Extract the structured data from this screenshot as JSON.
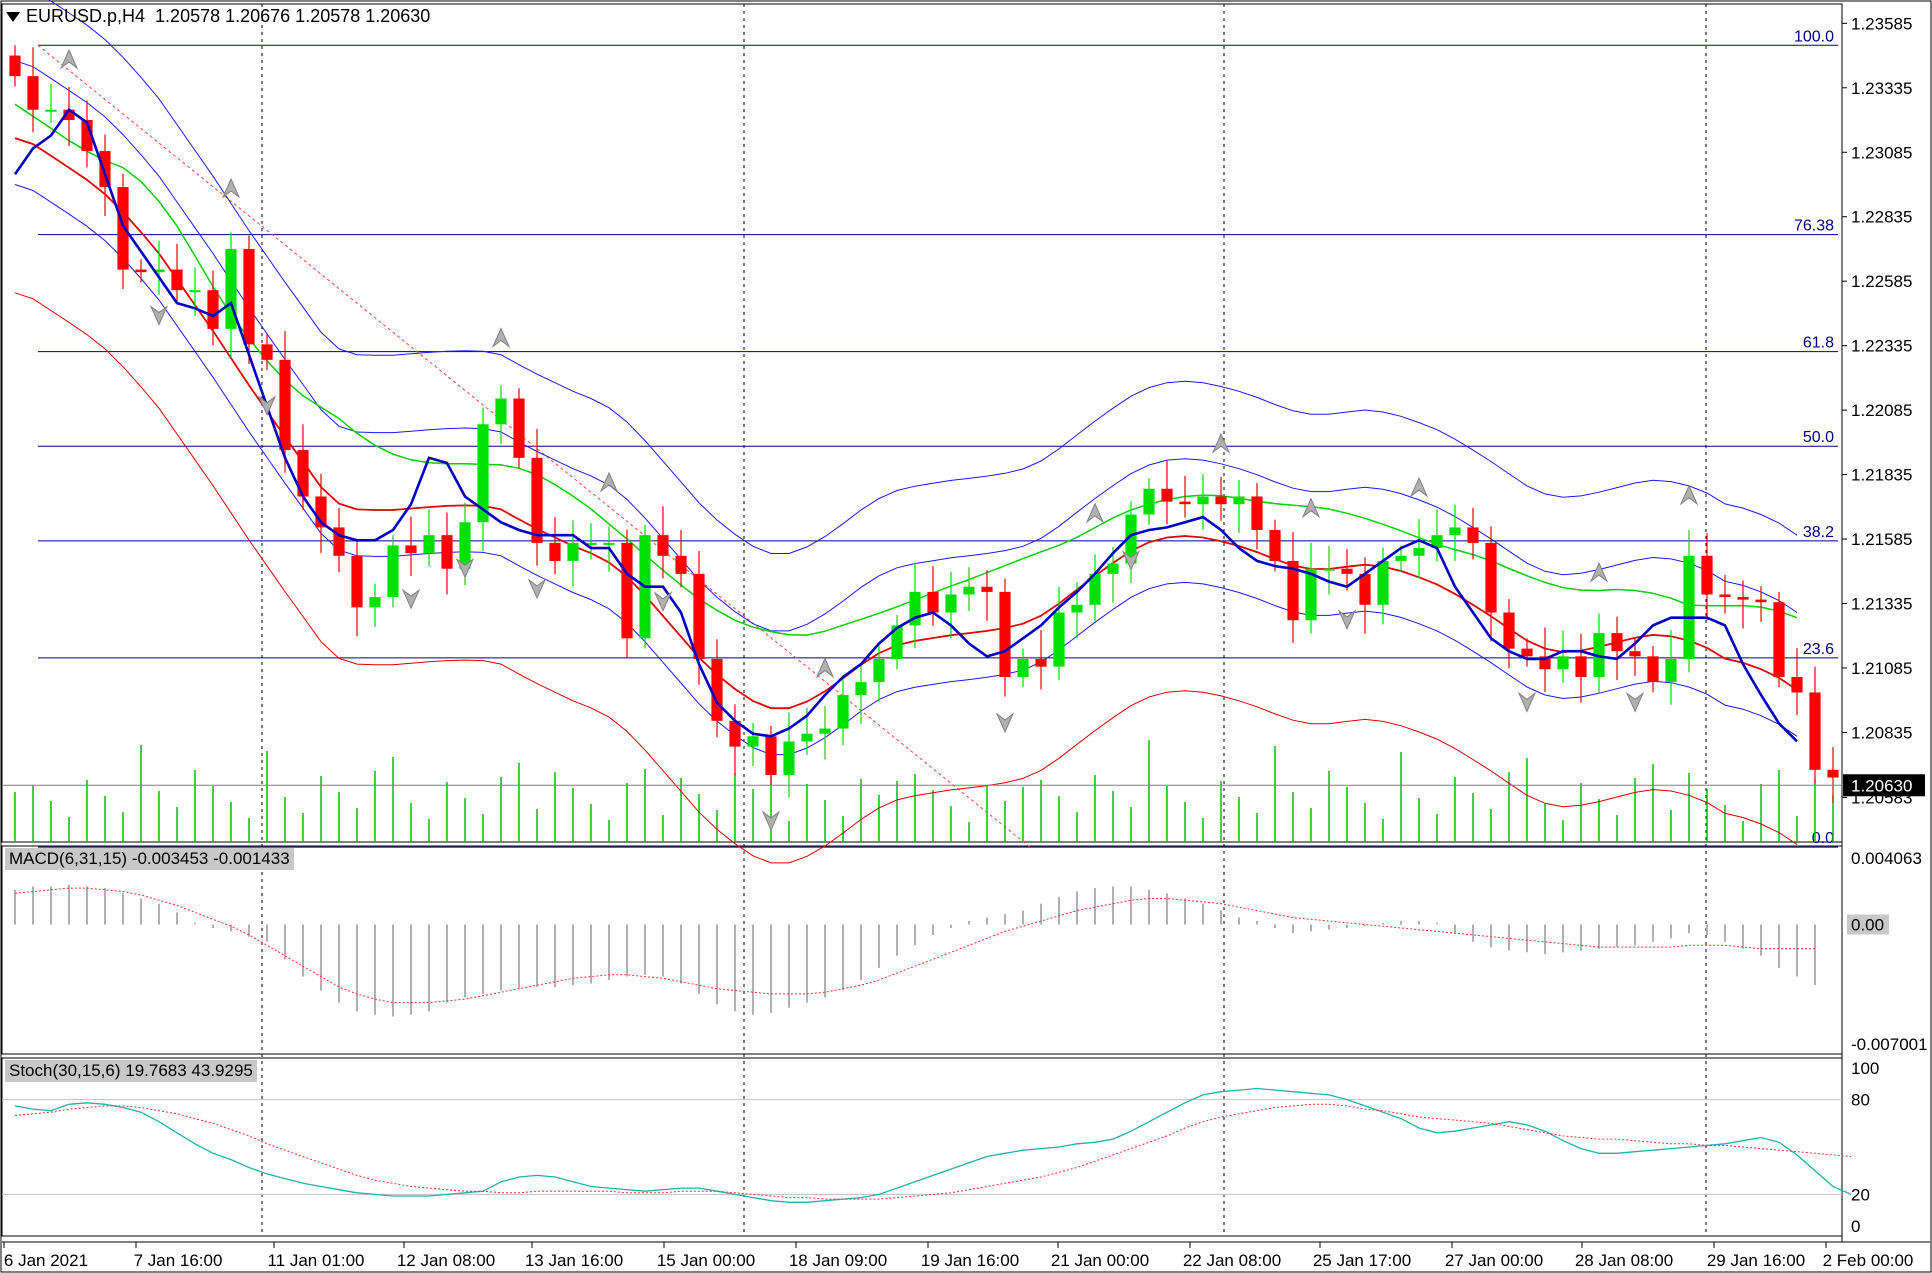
{
  "header": {
    "symbol": "EURUSD.p,H4",
    "ohlc": "1.20578 1.20676 1.20578 1.20630"
  },
  "price_axis": {
    "ticks": [
      "1.23585",
      "1.23335",
      "1.23085",
      "1.22835",
      "1.22585",
      "1.22335",
      "1.22085",
      "1.21835",
      "1.21585",
      "1.21335",
      "1.21085",
      "1.20835",
      "1.20583"
    ],
    "current_price": "1.20630"
  },
  "fib_levels": [
    "100.0",
    "76.38",
    "61.8",
    "50.0",
    "38.2",
    "23.6",
    "0.0"
  ],
  "time_axis": [
    "6 Jan 2021",
    "7 Jan 16:00",
    "11 Jan 01:00",
    "12 Jan 08:00",
    "13 Jan 16:00",
    "15 Jan 00:00",
    "18 Jan 09:00",
    "19 Jan 16:00",
    "21 Jan 00:00",
    "22 Jan 08:00",
    "25 Jan 17:00",
    "27 Jan 00:00",
    "28 Jan 08:00",
    "29 Jan 16:00",
    "2 Feb 00:00"
  ],
  "macd": {
    "label": "MACD(6,31,15) -0.003453 -0.001433",
    "ticks": [
      "0.004063",
      "0.00",
      "-0.007001"
    ]
  },
  "stoch": {
    "label": "Stoch(30,15,6) 19.7683 43.9295",
    "ticks": [
      "100",
      "80",
      "20",
      "0"
    ]
  },
  "colors": {
    "bull": "#00e000",
    "bear": "#ff0000",
    "ma_blue": "#0000c0",
    "band_blue": "#1a1aff",
    "ma_green": "#00d000",
    "ma_red": "#e00000",
    "volume": "#00c000",
    "stoch_main": "#20b2aa",
    "signal": "#ff3030"
  },
  "chart_data": [
    {
      "type": "candlestick",
      "title": "EURUSD.p,H4",
      "ylim": [
        1.2041,
        1.2366
      ],
      "x_categories": [
        "6 Jan 2021",
        "7 Jan 16:00",
        "11 Jan 01:00",
        "12 Jan 08:00",
        "13 Jan 16:00",
        "15 Jan 00:00",
        "18 Jan 09:00",
        "19 Jan 16:00",
        "21 Jan 00:00",
        "22 Jan 08:00",
        "25 Jan 17:00",
        "27 Jan 00:00",
        "28 Jan 08:00",
        "29 Jan 16:00",
        "2 Feb 00:00"
      ],
      "close": [
        1.2338,
        1.2325,
        1.2325,
        1.2321,
        1.2309,
        1.2295,
        1.2263,
        1.2262,
        1.2263,
        1.2255,
        1.2255,
        1.224,
        1.2271,
        1.2234,
        1.2228,
        1.2193,
        1.2175,
        1.2163,
        1.2152,
        1.2132,
        1.2136,
        1.2156,
        1.2153,
        1.216,
        1.2147,
        1.2165,
        1.2203,
        1.2213,
        1.219,
        1.2157,
        1.215,
        1.2157,
        1.2157,
        1.2157,
        1.212,
        1.216,
        1.2152,
        1.2145,
        1.2112,
        1.2088,
        1.2078,
        1.2082,
        1.2067,
        1.208,
        1.2083,
        1.2085,
        1.2098,
        1.2103,
        1.2112,
        1.2125,
        1.2138,
        1.213,
        1.2137,
        1.214,
        1.2138,
        1.2105,
        1.2112,
        1.2109,
        1.213,
        1.2133,
        1.2145,
        1.2149,
        1.2168,
        1.2178,
        1.2173,
        1.2172,
        1.2175,
        1.2172,
        1.2175,
        1.2162,
        1.215,
        1.2127,
        1.2147,
        1.2147,
        1.2145,
        1.2133,
        1.215,
        1.2152,
        1.2155,
        1.216,
        1.2163,
        1.2157,
        1.213,
        1.2116,
        1.2113,
        1.2108,
        1.2113,
        1.2105,
        1.2122,
        1.2115,
        1.2113,
        1.2103,
        1.2112,
        1.2152,
        1.2137,
        1.2136,
        1.2135,
        1.2134,
        1.2105,
        1.2099,
        1.2069,
        1.2066
      ],
      "ma_fast_blue": [
        1.23,
        1.231,
        1.2315,
        1.2325,
        1.232,
        1.23,
        1.228,
        1.227,
        1.226,
        1.225,
        1.2248,
        1.2245,
        1.225,
        1.223,
        1.221,
        1.219,
        1.2175,
        1.2165,
        1.216,
        1.2158,
        1.2158,
        1.2162,
        1.2172,
        1.219,
        1.2188,
        1.2175,
        1.217,
        1.2165,
        1.2162,
        1.216,
        1.216,
        1.216,
        1.2155,
        1.2155,
        1.2145,
        1.214,
        1.214,
        1.213,
        1.211,
        1.2095,
        1.2088,
        1.2083,
        1.2082,
        1.2085,
        1.209,
        1.2098,
        1.2105,
        1.211,
        1.2118,
        1.2124,
        1.2128,
        1.213,
        1.2125,
        1.2118,
        1.2113,
        1.2115,
        1.212,
        1.2125,
        1.2132,
        1.2138,
        1.2145,
        1.2153,
        1.216,
        1.2162,
        1.2163,
        1.2165,
        1.2167,
        1.2162,
        1.2155,
        1.215,
        1.2148,
        1.2147,
        1.2145,
        1.2142,
        1.214,
        1.2145,
        1.215,
        1.2155,
        1.2158,
        1.2155,
        1.214,
        1.213,
        1.212,
        1.2115,
        1.2112,
        1.2112,
        1.2115,
        1.2115,
        1.2113,
        1.2112,
        1.2118,
        1.2125,
        1.2128,
        1.2128,
        1.2128,
        1.2125,
        1.211,
        1.2098,
        1.2087,
        1.208
      ]
    },
    {
      "type": "bar",
      "title": "MACD(6,31,15) -0.003453 -0.001433",
      "ylim": [
        -0.007001,
        0.004063
      ],
      "series": [
        {
          "name": "MACD(6,31,15)",
          "values": [
            0.002,
            0.0022,
            0.0022,
            0.0023,
            0.0022,
            0.0021,
            0.0018,
            0.0015,
            0.0012,
            0.0007,
            0.0001,
            -0.0002,
            -0.0004,
            -0.0007,
            -0.001,
            -0.002,
            -0.003,
            -0.0038,
            -0.0045,
            -0.005,
            -0.0052,
            -0.0053,
            -0.0052,
            -0.005,
            -0.0045,
            -0.0042,
            -0.004,
            -0.0038,
            -0.0037,
            -0.0036,
            -0.0036,
            -0.0035,
            -0.0034,
            -0.0032,
            -0.003,
            -0.0029,
            -0.003,
            -0.0034,
            -0.004,
            -0.0046,
            -0.005,
            -0.0052,
            -0.0051,
            -0.0048,
            -0.0045,
            -0.0042,
            -0.0038,
            -0.0032,
            -0.0025,
            -0.0018,
            -0.0012,
            -0.0006,
            -0.0002,
            0.0002,
            0.0004,
            0.0006,
            0.0008,
            0.0012,
            0.0016,
            0.0019,
            0.0021,
            0.0022,
            0.0022,
            0.002,
            0.0018,
            0.0015,
            0.0012,
            0.0008,
            0.0004,
            0.0002,
            -0.0002,
            -0.0005,
            -0.0004,
            -0.0003,
            -0.0002,
            -0.0001,
            0.0001,
            0.0002,
            0.0002,
            0.0001,
            -0.0005,
            -0.001,
            -0.0013,
            -0.0015,
            -0.0016,
            -0.0017,
            -0.0016,
            -0.0015,
            -0.0014,
            -0.0013,
            -0.0012,
            -0.001,
            -0.0008,
            -0.0005,
            -0.0006,
            -0.001,
            -0.0014,
            -0.0018,
            -0.0025,
            -0.003,
            -0.0035
          ]
        },
        {
          "name": "signal",
          "values": [
            0.0018,
            0.0019,
            0.002,
            0.0021,
            0.0021,
            0.002,
            0.0019,
            0.0017,
            0.0014,
            0.0011,
            0.0007,
            0.0003,
            -0.0001,
            -0.0006,
            -0.0012,
            -0.0018,
            -0.0024,
            -0.003,
            -0.0036,
            -0.004,
            -0.0043,
            -0.0045,
            -0.0045,
            -0.0045,
            -0.0044,
            -0.0043,
            -0.0041,
            -0.0039,
            -0.0037,
            -0.0035,
            -0.0033,
            -0.0031,
            -0.003,
            -0.0029,
            -0.0029,
            -0.003,
            -0.0031,
            -0.0033,
            -0.0035,
            -0.0037,
            -0.0038,
            -0.0039,
            -0.004,
            -0.004,
            -0.004,
            -0.0039,
            -0.0037,
            -0.0035,
            -0.0032,
            -0.0028,
            -0.0024,
            -0.002,
            -0.0016,
            -0.0012,
            -0.0008,
            -0.0004,
            -0.0001,
            0.0002,
            0.0005,
            0.0008,
            0.001,
            0.0012,
            0.0014,
            0.0015,
            0.0015,
            0.0014,
            0.0013,
            0.0012,
            0.001,
            0.0008,
            0.0006,
            0.0004,
            0.0003,
            0.0002,
            0.0001,
            0.0,
            -0.0001,
            -0.0002,
            -0.0003,
            -0.0004,
            -0.0005,
            -0.0006,
            -0.0007,
            -0.0008,
            -0.0009,
            -0.001,
            -0.0011,
            -0.0012,
            -0.0013,
            -0.0013,
            -0.0013,
            -0.0013,
            -0.0013,
            -0.0012,
            -0.0012,
            -0.0012,
            -0.0013,
            -0.0014,
            -0.0014,
            -0.0014,
            -0.0014
          ]
        }
      ]
    },
    {
      "type": "line",
      "title": "Stoch(30,15,6) 19.7683 43.9295",
      "ylim": [
        0,
        100
      ],
      "series": [
        {
          "name": "Stoch(30,15,6)",
          "values": [
            76,
            74,
            73,
            77,
            78,
            77,
            75,
            72,
            66,
            59,
            52,
            46,
            42,
            37,
            33,
            30,
            27,
            25,
            23,
            21,
            20,
            19,
            19,
            19,
            20,
            21,
            22,
            28,
            31,
            32,
            31,
            28,
            25,
            24,
            23,
            22,
            23,
            24,
            24,
            22,
            20,
            18,
            16,
            15,
            15,
            16,
            17,
            18,
            20,
            24,
            28,
            32,
            36,
            40,
            44,
            46,
            48,
            49,
            50,
            52,
            53,
            55,
            60,
            66,
            72,
            78,
            83,
            85,
            86,
            87,
            86,
            85,
            84,
            83,
            80,
            76,
            72,
            68,
            62,
            59,
            60,
            62,
            64,
            66,
            64,
            60,
            54,
            49,
            46,
            46,
            47,
            48,
            49,
            50,
            51,
            52,
            54,
            56,
            53,
            45,
            35,
            25,
            20
          ]
        },
        {
          "name": "signal",
          "values": [
            70,
            71,
            72,
            74,
            75,
            76,
            76,
            75,
            73,
            71,
            68,
            65,
            61,
            57,
            52,
            48,
            44,
            40,
            36,
            32,
            29,
            27,
            25,
            24,
            23,
            22,
            22,
            21,
            21,
            22,
            22,
            22,
            22,
            22,
            21,
            21,
            21,
            22,
            22,
            22,
            21,
            20,
            19,
            18,
            18,
            17,
            17,
            17,
            17,
            18,
            19,
            20,
            21,
            23,
            25,
            27,
            29,
            31,
            34,
            37,
            41,
            45,
            49,
            53,
            57,
            62,
            66,
            69,
            71,
            73,
            75,
            76,
            77,
            77,
            76,
            74,
            73,
            71,
            69,
            68,
            67,
            66,
            65,
            63,
            61,
            59,
            57,
            56,
            55,
            55,
            54,
            53,
            52,
            52,
            51,
            51,
            50,
            49,
            48,
            47,
            46,
            45,
            44
          ]
        }
      ]
    }
  ]
}
